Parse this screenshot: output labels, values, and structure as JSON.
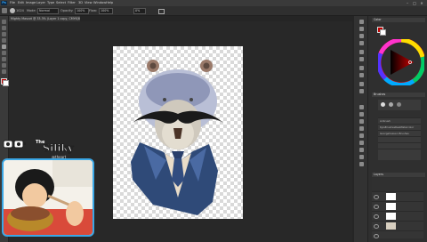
{
  "app": {
    "logo": "Ps"
  },
  "menu": [
    "File",
    "Edit",
    "Image",
    "Layer",
    "Type",
    "Select",
    "Filter",
    "3D",
    "View",
    "Window",
    "Help"
  ],
  "window_controls": {
    "minimize": "–",
    "maximize": "□",
    "close": "✕"
  },
  "options_bar": {
    "brush_size": "1024",
    "mode_label": "Mode:",
    "mode_value": "Normal",
    "opacity_label": "Opacity:",
    "opacity_value": "100%",
    "flow_label": "Flow:",
    "flow_value": "100%",
    "smoothing_value": "0%"
  },
  "document_tab": "Mighty Mascot @ 33.3% (Layer 1 copy, CMYK/8) *",
  "stream_overlay": {
    "logo_line1": "The",
    "logo_line2": "Siliky",
    "logo_line3": "@theart"
  },
  "panels": {
    "color_title": "Color",
    "brushes_title": "Brushes",
    "layers_title": "Layers",
    "brush_items": [
      "Airbrush",
      "KyleBrushesRealWatercolor",
      "Georgeheaven Brushes",
      "",
      "",
      ""
    ]
  },
  "colors": {
    "accent": "#31a8ff",
    "webcam_border": "#3aa7e6",
    "foreground": "#c00000"
  },
  "icons": [
    "move-tool-icon",
    "marquee-tool-icon",
    "lasso-tool-icon",
    "crop-tool-icon",
    "brush-tool-icon",
    "eraser-tool-icon",
    "type-tool-icon",
    "hand-tool-icon",
    "zoom-tool-icon"
  ]
}
